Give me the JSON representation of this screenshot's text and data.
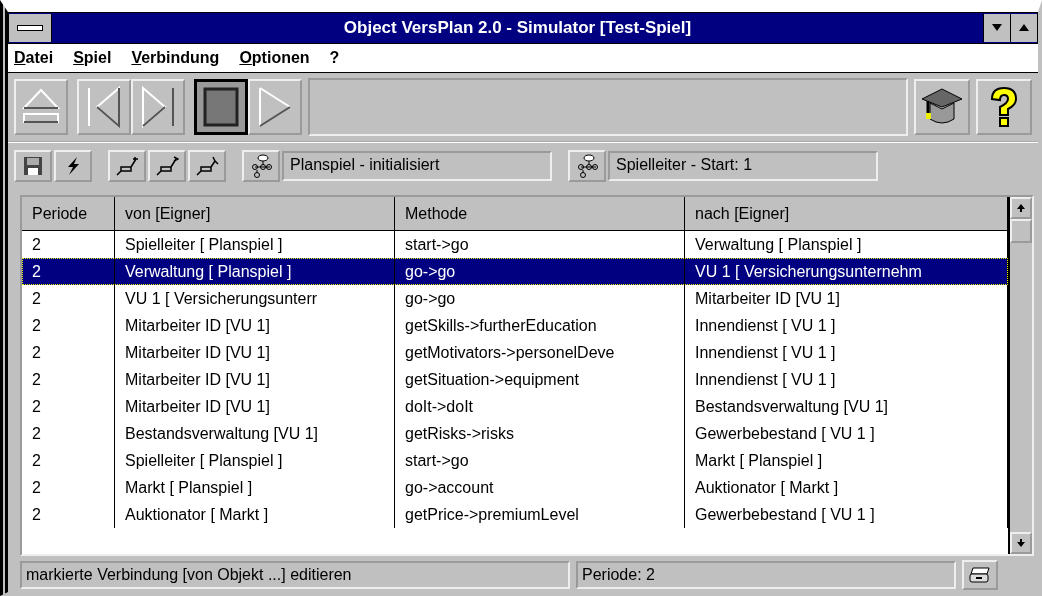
{
  "window": {
    "title": "Object VersPlan 2.0 - Simulator [Test-Spiel]"
  },
  "menu": [
    {
      "label": "Datei"
    },
    {
      "label": "Spiel"
    },
    {
      "label": "Verbindung"
    },
    {
      "label": "Optionen"
    },
    {
      "label": "?"
    }
  ],
  "media_buttons": [
    {
      "kind": "eject",
      "pressed": false
    },
    {
      "kind": "first",
      "pressed": false
    },
    {
      "kind": "last",
      "pressed": false
    },
    {
      "kind": "stop",
      "pressed": true
    },
    {
      "kind": "play",
      "pressed": false
    }
  ],
  "help_buttons": [
    {
      "kind": "tutor"
    },
    {
      "kind": "help"
    }
  ],
  "tool_buttons": [
    {
      "kind": "save"
    },
    {
      "kind": "flash"
    },
    {
      "kind": "link-a"
    },
    {
      "kind": "link-b"
    },
    {
      "kind": "link-c"
    }
  ],
  "status_fields": [
    {
      "value": "Planspiel - initialisiert"
    },
    {
      "value": "Spielleiter - Start: 1"
    }
  ],
  "table": {
    "columns": [
      "Periode",
      "von [Eigner]",
      "Methode",
      "nach [Eigner]"
    ],
    "rows": [
      {
        "cells": [
          "2",
          "Spielleiter [ Planspiel ]",
          "start->go",
          "Verwaltung [ Planspiel ]"
        ],
        "selected": false
      },
      {
        "cells": [
          "2",
          "Verwaltung [ Planspiel ]",
          "go->go",
          "VU 1 [ Versicherungsunternehm"
        ],
        "selected": true
      },
      {
        "cells": [
          "2",
          "VU 1 [ Versicherungsunterr",
          "go->go",
          "Mitarbeiter ID [VU 1]"
        ],
        "selected": false
      },
      {
        "cells": [
          "2",
          "Mitarbeiter ID [VU 1]",
          "getSkills->furtherEducation",
          "Innendienst [ VU 1 ]"
        ],
        "selected": false
      },
      {
        "cells": [
          "2",
          "Mitarbeiter ID [VU 1]",
          "getMotivators->personelDeve",
          "Innendienst [ VU 1 ]"
        ],
        "selected": false
      },
      {
        "cells": [
          "2",
          "Mitarbeiter ID [VU 1]",
          "getSituation->equipment",
          "Innendienst [ VU 1 ]"
        ],
        "selected": false
      },
      {
        "cells": [
          "2",
          "Mitarbeiter ID [VU 1]",
          "doIt->doIt",
          "Bestandsverwaltung [VU 1]"
        ],
        "selected": false
      },
      {
        "cells": [
          "2",
          "Bestandsverwaltung [VU 1]",
          "getRisks->risks",
          "Gewerbebestand [ VU 1 ]"
        ],
        "selected": false
      },
      {
        "cells": [
          "2",
          "Spielleiter [ Planspiel ]",
          "start->go",
          "Markt [ Planspiel ]"
        ],
        "selected": false
      },
      {
        "cells": [
          "2",
          "Markt [ Planspiel ]",
          "go->account",
          "Auktionator [ Markt ]"
        ],
        "selected": false
      },
      {
        "cells": [
          "2",
          "Auktionator [ Markt ]",
          "getPrice->premiumLevel",
          "Gewerbebestand [ VU 1 ]"
        ],
        "selected": false
      }
    ]
  },
  "status_bar": {
    "message": "markierte Verbindung [von Objekt ...] editieren",
    "period": "Periode: 2"
  }
}
